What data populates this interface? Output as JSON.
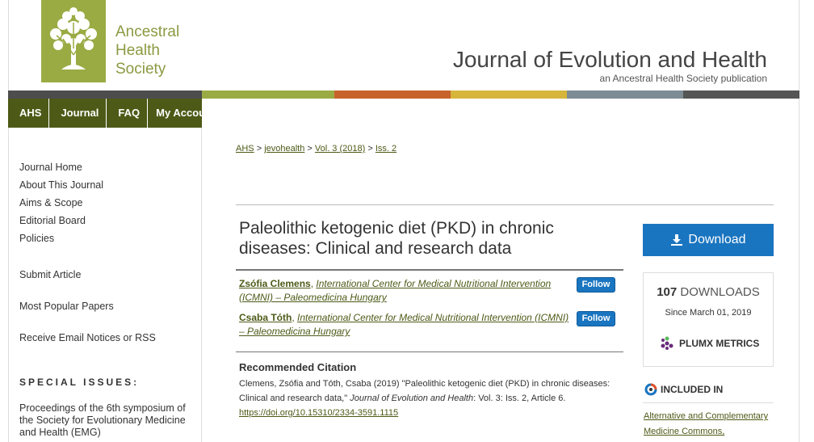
{
  "header": {
    "logo_lines": [
      "Ancestral",
      "Health",
      "Society"
    ],
    "journal_title": "Journal of Evolution and Health",
    "journal_subtitle": "an Ancestral Health Society publication",
    "colors": [
      "#4d4d4d",
      "#9aab44",
      "#c8622b",
      "#d6b53a",
      "#7d8b94",
      "#555555"
    ]
  },
  "nav": {
    "items": [
      "AHS",
      "Journal",
      "FAQ",
      "My Account"
    ]
  },
  "sidebar": {
    "links": [
      "Journal Home",
      "About This Journal",
      "Aims & Scope",
      "Editorial Board",
      "Policies"
    ],
    "submit": "Submit Article",
    "popular": "Most Popular Papers",
    "notices": "Receive Email Notices or RSS",
    "special_heading": "SPECIAL ISSUES:",
    "special_item": "Proceedings of the 6th symposium of the Society for Evolutionary Medicine and Health (EMG)"
  },
  "breadcrumb": {
    "items": [
      "AHS",
      "jevohealth",
      "Vol. 3 (2018)",
      "Iss. 2"
    ],
    "sep": ">"
  },
  "article": {
    "title": "Paleolithic ketogenic diet (PKD) in chronic diseases: Clinical and research data",
    "authors": [
      {
        "name": "Zsófia Clemens",
        "affiliation": "International Center for Medical Nutritional Intervention (ICMNI) – Paleomedicina Hungary"
      },
      {
        "name": "Csaba Tóth",
        "affiliation": "International Center for Medical Nutritional Intervention (ICMNI) – Paleomedicina Hungary"
      }
    ],
    "follow_label": "Follow",
    "citation_heading": "Recommended Citation",
    "citation_prefix": "Clemens, Zsófia and Tóth, Csaba (2019) \"Paleolithic ketogenic diet (PKD) in chronic diseases: Clinical and research data,\" ",
    "citation_journal": "Journal of Evolution and Health",
    "citation_suffix": ": Vol. 3: Iss. 2, Article 6.",
    "doi": "https://doi.org/10.15310/2334-3591.1115"
  },
  "right": {
    "download_label": "Download",
    "downloads_count": "107",
    "downloads_label": "DOWNLOADS",
    "since": "Since March 01, 2019",
    "plumx": "PLUMX METRICS",
    "included_in": "INCLUDED IN",
    "included_link": "Alternative and Complementary Medicine Commons,"
  },
  "icons": {
    "logo": "tree-logo-icon",
    "download": "download-icon",
    "plumx": "plumx-icon",
    "included": "included-in-icon"
  }
}
